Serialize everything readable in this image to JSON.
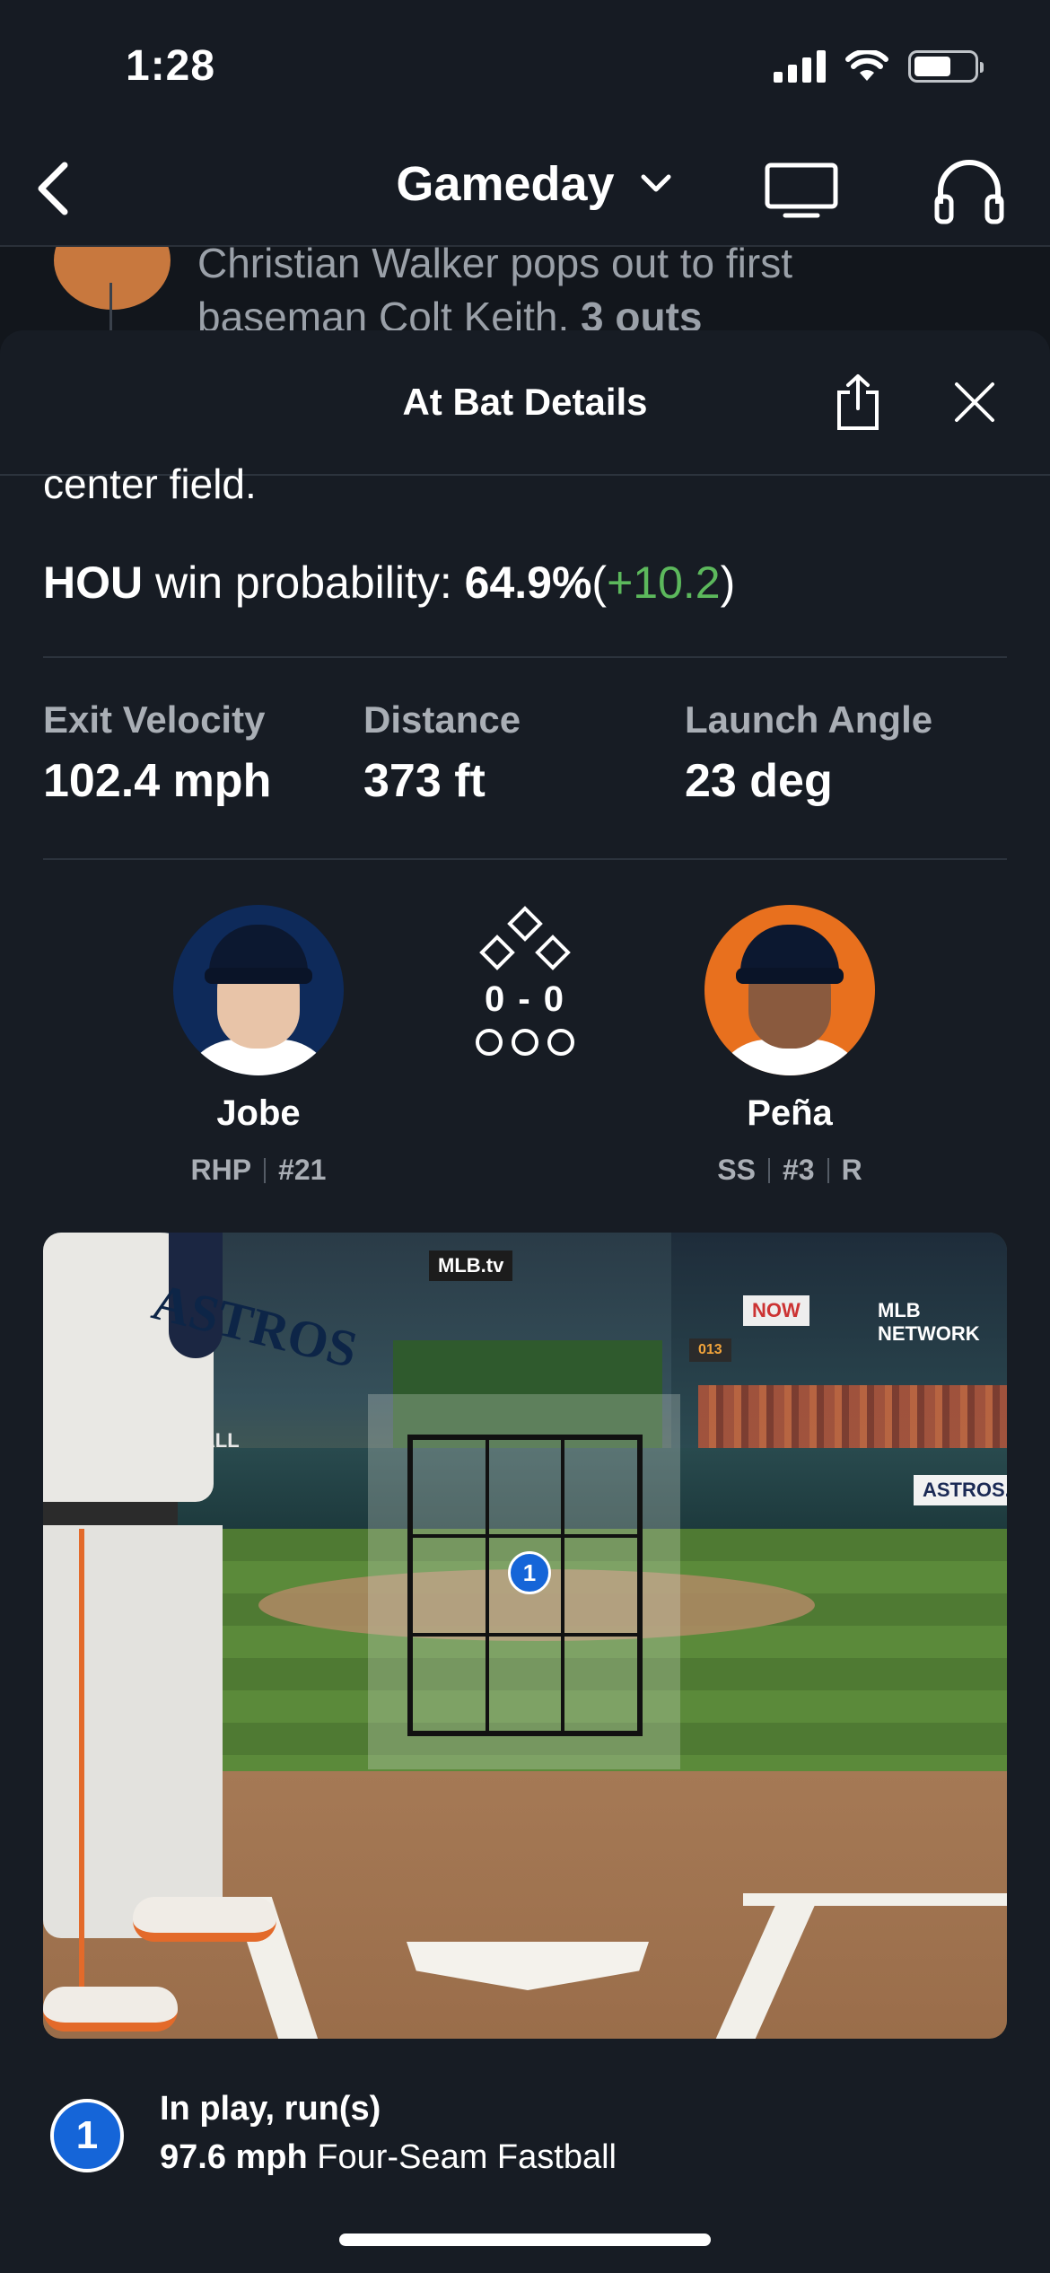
{
  "status_bar": {
    "time": "1:28",
    "battery_level": 0.62
  },
  "nav": {
    "title": "Gameday"
  },
  "behind_play": {
    "line1": "Christian Walker pops out to first",
    "line2_prefix": "baseman Colt Keith.",
    "line2_emphasis": "3 outs"
  },
  "sheet": {
    "title": "At Bat Details",
    "cut_text": "center field.",
    "win_prob": {
      "team": "HOU",
      "label": "win probability:",
      "value": "64.9%",
      "open_paren": "(",
      "delta": "+10.2",
      "close_paren": ")",
      "delta_color": "#5cb85c"
    },
    "stats": [
      {
        "label": "Exit Velocity",
        "value": "102.4 mph"
      },
      {
        "label": "Distance",
        "value": "373 ft"
      },
      {
        "label": "Launch Angle",
        "value": "23 deg"
      }
    ],
    "pitcher": {
      "name": "Jobe",
      "position": "RHP",
      "number": "#21",
      "avatar_bg": "#0e2a5a"
    },
    "batter": {
      "name": "Peña",
      "position": "SS",
      "number": "#3",
      "bats": "R",
      "avatar_bg": "#e8701e"
    },
    "count": {
      "balls_strikes": "0 - 0",
      "outs": 0
    },
    "pitch_view": {
      "pitch_number": "1",
      "jersey_text": "ASTROS",
      "signs": [
        "MLB.tv",
        "NOW",
        "MLB NETWORK",
        "ASTROS.COM",
        "BALL",
        "013"
      ]
    },
    "result": {
      "number": "1",
      "title": "In play, run(s)",
      "speed": "97.6 mph",
      "pitch_type": "Four-Seam Fastball",
      "accent": "#1565d8"
    }
  }
}
